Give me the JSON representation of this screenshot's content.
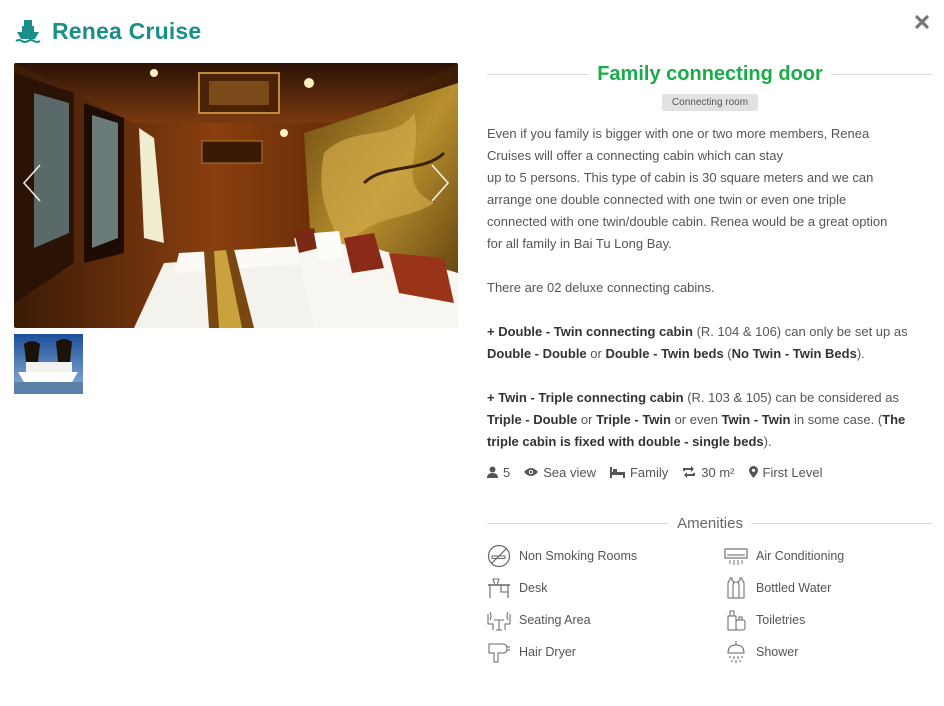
{
  "header": {
    "brand": "Renea Cruise",
    "ship_icon": "ship-icon",
    "close_icon": "close-icon"
  },
  "gallery": {
    "prev_icon": "chevron-left-icon",
    "next_icon": "chevron-right-icon"
  },
  "room": {
    "title": "Family connecting door",
    "tag": "Connecting room",
    "desc1_lines": [
      "Even if you family is bigger with one or two more members, Renea",
      "Cruises will offer a connecting cabin which can stay",
      "up to 5 persons. This type of cabin is 30 square meters and we can",
      "arrange one double connected with one twin or even one triple",
      "connected with one twin/double cabin. Renea would be a great option",
      "for all family in Bai Tu Long Bay."
    ],
    "desc2": "There are 02 deluxe connecting cabins.",
    "p3": {
      "a": "+ Double - Twin connecting cabin",
      "b": " (R. 104 & 106) can only be set up as ",
      "c": "Double - Double",
      "d": " or ",
      "e": "Double - Twin beds",
      "f": " (",
      "g": "No Twin - Twin Beds",
      "h": ")."
    },
    "p4": {
      "a": "+ Twin - Triple connecting cabin",
      "b": " (R. 103 & 105) can be considered as ",
      "c": "Triple - Double",
      "d": " or ",
      "e": "Triple - Twin",
      "f": " or even ",
      "g": "Twin - Twin",
      "h": " in some case. (",
      "i": "The triple cabin is fixed with double - single beds",
      "j": ")."
    }
  },
  "meta": {
    "guests": "5",
    "view": "Sea view",
    "bed": "Family",
    "size": "30 m²",
    "level": "First Level"
  },
  "amenities": {
    "title": "Amenities",
    "items": [
      {
        "label": "Non Smoking Rooms",
        "icon": "no-smoking-icon"
      },
      {
        "label": "Air Conditioning",
        "icon": "air-conditioner-icon"
      },
      {
        "label": "Desk",
        "icon": "desk-icon"
      },
      {
        "label": "Bottled Water",
        "icon": "bottled-water-icon"
      },
      {
        "label": "Seating Area",
        "icon": "seating-area-icon"
      },
      {
        "label": "Toiletries",
        "icon": "toiletries-icon"
      },
      {
        "label": "Hair Dryer",
        "icon": "hair-dryer-icon"
      },
      {
        "label": "Shower",
        "icon": "shower-icon"
      }
    ]
  },
  "colors": {
    "brand": "#1a8f8a",
    "title": "#1bab4b",
    "text": "#555555"
  }
}
